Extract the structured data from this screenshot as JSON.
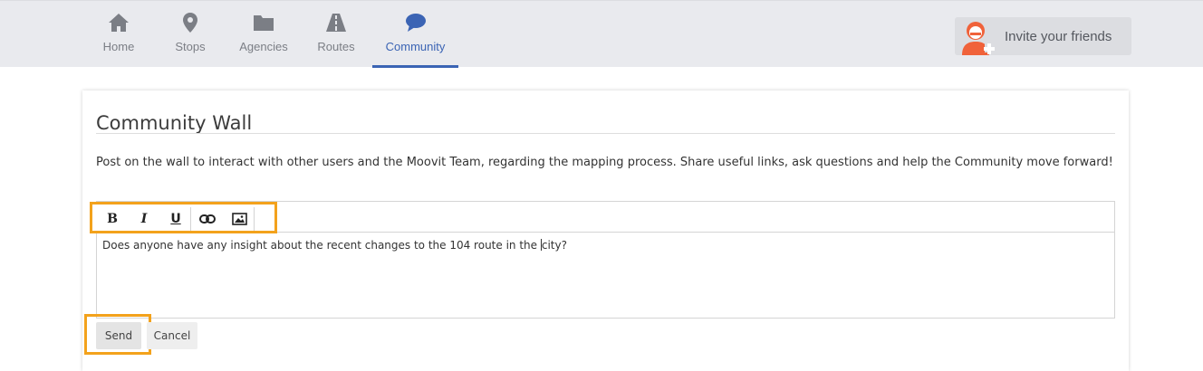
{
  "nav": {
    "tabs": [
      {
        "label": "Home",
        "icon": "home-icon"
      },
      {
        "label": "Stops",
        "icon": "map-pin-icon"
      },
      {
        "label": "Agencies",
        "icon": "folder-icon"
      },
      {
        "label": "Routes",
        "icon": "road-icon"
      },
      {
        "label": "Community",
        "icon": "chat-bubble-icon",
        "active": true
      }
    ],
    "invite_label": "Invite your friends"
  },
  "wall": {
    "title": "Community Wall",
    "description": "Post on the wall to interact with other users and the Moovit Team, regarding the mapping process. Share useful links, ask questions and help the Community move forward!",
    "toolbar": {
      "bold": "B",
      "italic": "I",
      "underline": "U",
      "link_icon": "link-icon",
      "image_icon": "image-icon"
    },
    "message_before_caret": "Does anyone have any insight about the recent changes to the 104 route in the ",
    "message_after_caret": "city?",
    "send_label": "Send",
    "cancel_label": "Cancel"
  },
  "colors": {
    "accent": "#3b64b4",
    "highlight": "#f3a21c",
    "nav_bg": "#e9eaee",
    "avatar": "#f0623a"
  }
}
